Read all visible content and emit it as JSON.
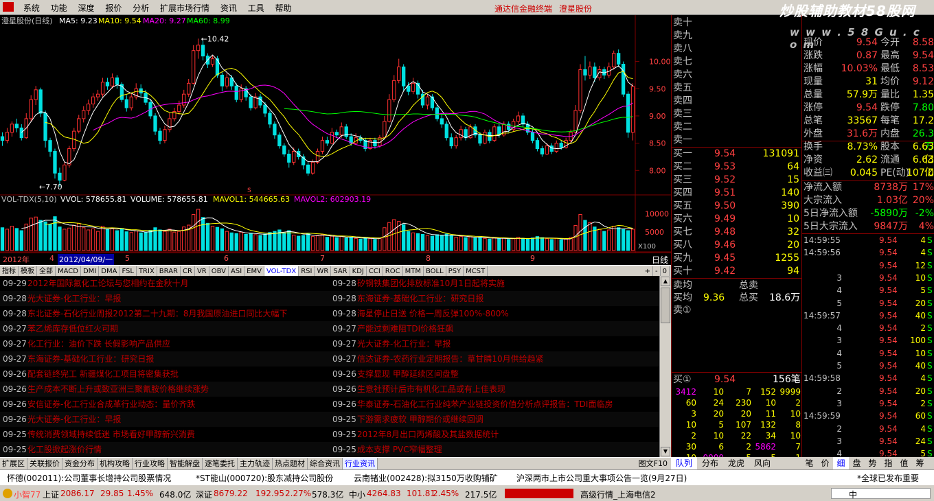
{
  "menu": {
    "items": [
      "系统",
      "功能",
      "深度",
      "报价",
      "分析",
      "扩展市场行情",
      "资讯",
      "工具",
      "帮助"
    ],
    "title_app": "通达信金融终端",
    "title_stock": "澄星股份",
    "watermark": "炒股辅助教材58股网",
    "watermark_url": "w w w . 5 8 G u . c o m"
  },
  "chart": {
    "header": {
      "name": "澄星股份(日线)",
      "ma5": "MA5: 9.23",
      "ma10": "MA10: 9.54",
      "ma20": "MA20: 9.27",
      "ma60": "MA60: 8.99"
    },
    "y_labels": [
      "10.00",
      "9.50",
      "9.00",
      "8.50",
      "8.00"
    ],
    "y_values": [
      10.0,
      9.5,
      9.0,
      8.5,
      8.0
    ],
    "y_range": [
      7.55,
      10.65
    ],
    "high_label": "10.42",
    "low_label": "7.70",
    "marker_label": "S",
    "vol_header": {
      "name": "VOL-TDX(5,10)",
      "vvol": "VVOL: 578655.81",
      "volume": "VOLUME: 578655.81",
      "mavol1": "MAVOL1: 544665.63",
      "mavol2": "MAVOL2: 602903.19"
    },
    "vol_labels": [
      "10000",
      "5000"
    ],
    "vol_values": [
      10000,
      5000
    ],
    "vol_range": [
      0,
      12500
    ],
    "vol_unit": "X100",
    "x_labels": [
      "2012年",
      "4",
      "5",
      "6",
      "7",
      "8",
      "9"
    ],
    "selected_date": "2012/04/09/一",
    "day_button": "日线"
  },
  "chart_data": {
    "type": "candlestick",
    "bars": [
      [
        8.62,
        8.55,
        8.7,
        8.45,
        6200
      ],
      [
        8.55,
        8.7,
        8.78,
        8.5,
        5800
      ],
      [
        8.7,
        8.85,
        8.9,
        8.62,
        6600
      ],
      [
        8.85,
        8.78,
        8.95,
        8.7,
        6000
      ],
      [
        8.78,
        8.6,
        8.85,
        8.55,
        5400
      ],
      [
        8.6,
        8.95,
        9.05,
        8.58,
        7200
      ],
      [
        8.95,
        9.3,
        9.38,
        8.9,
        8800
      ],
      [
        9.3,
        9.48,
        9.55,
        9.2,
        9100
      ],
      [
        9.48,
        9.05,
        9.52,
        8.98,
        8200
      ],
      [
        9.05,
        8.55,
        9.1,
        8.42,
        7800
      ],
      [
        8.55,
        8.35,
        8.6,
        8.25,
        7100
      ],
      [
        8.35,
        7.95,
        8.4,
        7.85,
        9200
      ],
      [
        7.95,
        7.82,
        8.05,
        7.7,
        6400
      ],
      [
        7.82,
        8.1,
        8.15,
        7.8,
        5800
      ],
      [
        8.1,
        8.4,
        8.45,
        8.05,
        6100
      ],
      [
        8.4,
        8.72,
        8.78,
        8.35,
        6800
      ],
      [
        8.72,
        8.95,
        9.02,
        8.68,
        7400
      ],
      [
        8.95,
        9.1,
        9.18,
        8.88,
        6200
      ],
      [
        9.1,
        9.22,
        9.3,
        9.02,
        5600
      ],
      [
        9.22,
        9.35,
        9.42,
        9.15,
        5900
      ],
      [
        9.35,
        9.4,
        9.48,
        9.28,
        5200
      ],
      [
        9.4,
        9.62,
        9.7,
        9.35,
        6600
      ],
      [
        9.62,
        9.55,
        9.7,
        9.48,
        5800
      ],
      [
        9.55,
        9.7,
        9.78,
        9.5,
        6100
      ],
      [
        9.7,
        9.58,
        9.75,
        9.5,
        5400
      ],
      [
        9.58,
        9.3,
        9.62,
        9.25,
        6000
      ],
      [
        9.3,
        9.15,
        9.38,
        9.08,
        5100
      ],
      [
        9.15,
        9.35,
        9.42,
        9.1,
        4900
      ],
      [
        9.35,
        9.5,
        9.6,
        9.3,
        5300
      ],
      [
        9.5,
        9.42,
        9.58,
        9.35,
        4800
      ],
      [
        9.42,
        9.25,
        9.48,
        9.2,
        5000
      ],
      [
        9.25,
        9.0,
        9.3,
        8.95,
        5500
      ],
      [
        9.0,
        8.72,
        9.05,
        8.65,
        6200
      ],
      [
        8.72,
        8.55,
        8.78,
        8.48,
        5600
      ],
      [
        8.55,
        8.75,
        8.82,
        8.5,
        5200
      ],
      [
        8.75,
        8.95,
        9.05,
        8.7,
        5800
      ],
      [
        8.95,
        9.08,
        9.15,
        8.9,
        5000
      ],
      [
        9.08,
        9.2,
        9.28,
        9.02,
        5200
      ],
      [
        9.2,
        9.4,
        9.48,
        9.15,
        6400
      ],
      [
        9.4,
        9.6,
        9.68,
        9.35,
        6900
      ],
      [
        9.6,
        10.2,
        10.3,
        9.58,
        9800
      ],
      [
        10.2,
        10.3,
        10.42,
        10.05,
        11200
      ],
      [
        10.3,
        10.1,
        10.38,
        10.02,
        9000
      ],
      [
        10.1,
        9.95,
        10.15,
        9.88,
        7400
      ],
      [
        9.95,
        10.05,
        10.12,
        9.9,
        6600
      ],
      [
        10.05,
        9.75,
        10.1,
        9.7,
        6300
      ],
      [
        9.75,
        9.55,
        9.8,
        9.45,
        5900
      ],
      [
        9.55,
        9.7,
        9.78,
        9.5,
        5200
      ],
      [
        9.7,
        9.55,
        9.75,
        9.48,
        4800
      ],
      [
        9.55,
        9.3,
        9.6,
        9.25,
        4600
      ],
      [
        9.3,
        9.5,
        9.58,
        9.25,
        5000
      ],
      [
        9.5,
        9.35,
        9.55,
        9.28,
        4400
      ],
      [
        9.35,
        9.15,
        9.4,
        9.1,
        4700
      ],
      [
        9.15,
        9.35,
        9.42,
        9.12,
        4300
      ],
      [
        9.35,
        9.2,
        9.4,
        9.15,
        4100
      ],
      [
        9.2,
        9.05,
        9.25,
        8.98,
        4500
      ],
      [
        9.05,
        8.85,
        9.1,
        8.78,
        4900
      ],
      [
        8.85,
        8.65,
        8.9,
        8.58,
        5200
      ],
      [
        8.65,
        8.45,
        8.7,
        8.4,
        5600
      ],
      [
        8.45,
        8.3,
        8.5,
        8.25,
        4800
      ],
      [
        8.3,
        8.15,
        8.38,
        8.05,
        5400
      ],
      [
        8.15,
        8.35,
        8.42,
        8.1,
        4200
      ],
      [
        8.35,
        8.25,
        8.4,
        8.2,
        3900
      ],
      [
        8.25,
        8.1,
        8.3,
        8.02,
        4100
      ],
      [
        8.1,
        7.95,
        8.15,
        7.9,
        4600
      ],
      [
        7.95,
        8.15,
        8.2,
        7.92,
        3800
      ],
      [
        8.15,
        8.35,
        8.4,
        8.12,
        4000
      ],
      [
        8.35,
        8.55,
        8.62,
        8.3,
        4400
      ],
      [
        8.55,
        8.5,
        8.62,
        8.45,
        3600
      ],
      [
        8.5,
        8.7,
        8.78,
        8.48,
        3900
      ],
      [
        8.7,
        8.65,
        8.75,
        8.6,
        3500
      ],
      [
        8.65,
        8.8,
        8.88,
        8.6,
        3800
      ],
      [
        8.8,
        8.62,
        8.85,
        8.58,
        3400
      ],
      [
        8.62,
        8.5,
        8.68,
        8.45,
        3600
      ],
      [
        8.5,
        8.6,
        8.68,
        8.48,
        3300
      ],
      [
        8.6,
        8.55,
        8.65,
        8.5,
        3100
      ],
      [
        8.55,
        8.4,
        8.6,
        8.35,
        3500
      ],
      [
        8.4,
        8.55,
        8.6,
        8.38,
        3200
      ],
      [
        8.55,
        8.45,
        8.6,
        8.4,
        3000
      ],
      [
        8.45,
        8.6,
        8.65,
        8.42,
        3400
      ],
      [
        8.6,
        8.9,
        9.0,
        8.58,
        6200
      ],
      [
        8.9,
        9.3,
        9.4,
        8.88,
        7600
      ],
      [
        9.3,
        9.65,
        9.75,
        9.25,
        8400
      ],
      [
        9.65,
        9.9,
        10.05,
        9.6,
        7900
      ],
      [
        9.9,
        9.55,
        9.95,
        9.45,
        7000
      ],
      [
        9.55,
        9.45,
        9.62,
        9.38,
        5200
      ],
      [
        9.45,
        9.6,
        9.7,
        9.4,
        4800
      ],
      [
        9.6,
        9.4,
        9.65,
        9.32,
        4600
      ],
      [
        9.4,
        9.2,
        9.48,
        9.15,
        4400
      ],
      [
        9.2,
        9.35,
        9.4,
        9.12,
        4100
      ],
      [
        9.35,
        9.15,
        9.4,
        9.1,
        3900
      ],
      [
        9.15,
        8.95,
        9.2,
        8.9,
        4300
      ],
      [
        8.95,
        8.85,
        9.02,
        8.78,
        4000
      ],
      [
        8.85,
        8.6,
        8.9,
        8.55,
        4500
      ],
      [
        8.6,
        8.45,
        8.68,
        8.4,
        4100
      ],
      [
        8.45,
        8.6,
        8.65,
        8.4,
        3600
      ],
      [
        8.6,
        8.75,
        8.82,
        8.55,
        3800
      ],
      [
        8.75,
        8.6,
        8.8,
        8.55,
        3500
      ],
      [
        8.6,
        8.8,
        8.85,
        8.58,
        3700
      ],
      [
        8.8,
        8.65,
        8.85,
        8.6,
        3400
      ],
      [
        8.65,
        8.5,
        8.7,
        8.45,
        3600
      ],
      [
        8.5,
        8.7,
        8.75,
        8.48,
        3300
      ],
      [
        8.7,
        8.55,
        8.75,
        8.5,
        3100
      ],
      [
        8.55,
        8.8,
        8.85,
        8.52,
        3500
      ],
      [
        8.8,
        8.65,
        8.85,
        8.6,
        3200
      ],
      [
        8.65,
        8.85,
        8.9,
        8.62,
        3400
      ],
      [
        8.85,
        8.75,
        8.9,
        8.7,
        3000
      ],
      [
        8.75,
        8.9,
        8.95,
        8.72,
        3200
      ],
      [
        8.9,
        9.0,
        9.08,
        8.85,
        3600
      ],
      [
        9.0,
        8.85,
        9.05,
        8.8,
        3300
      ],
      [
        8.85,
        8.7,
        8.9,
        8.65,
        3100
      ],
      [
        8.7,
        8.55,
        8.75,
        8.5,
        3400
      ],
      [
        8.55,
        8.4,
        8.6,
        8.35,
        3800
      ],
      [
        8.4,
        8.3,
        8.45,
        8.25,
        3500
      ],
      [
        8.3,
        8.45,
        8.5,
        8.28,
        3200
      ],
      [
        8.45,
        8.35,
        8.5,
        8.3,
        3000
      ],
      [
        8.35,
        8.5,
        8.55,
        8.32,
        3300
      ],
      [
        8.5,
        8.42,
        8.55,
        8.38,
        2900
      ],
      [
        8.42,
        8.55,
        8.6,
        8.4,
        3100
      ],
      [
        8.55,
        8.7,
        8.75,
        8.5,
        3600
      ],
      [
        8.7,
        9.1,
        9.2,
        8.68,
        6800
      ],
      [
        9.1,
        9.85,
        9.95,
        9.05,
        9800
      ],
      [
        9.85,
        9.75,
        10.1,
        9.65,
        8200
      ],
      [
        9.75,
        9.9,
        10.0,
        9.68,
        7600
      ],
      [
        9.9,
        9.7,
        9.98,
        9.62,
        6400
      ],
      [
        9.7,
        9.85,
        9.92,
        9.65,
        5800
      ],
      [
        9.85,
        9.75,
        9.9,
        9.68,
        5200
      ],
      [
        9.75,
        9.9,
        9.98,
        9.7,
        5600
      ],
      [
        9.9,
        10.15,
        10.2,
        9.85,
        6600
      ],
      [
        10.15,
        9.95,
        10.22,
        9.9,
        6200
      ],
      [
        9.95,
        9.4,
        10.0,
        9.35,
        5800
      ],
      [
        9.4,
        8.7,
        9.45,
        8.6,
        5400
      ],
      [
        8.7,
        9.54,
        9.6,
        8.55,
        5786
      ]
    ]
  },
  "indicator_tabs": [
    "指标",
    "模板",
    "全部",
    "MACD",
    "DMI",
    "DMA",
    "FSL",
    "TRIX",
    "BRAR",
    "CR",
    "VR",
    "OBV",
    "ASI",
    "EMV",
    "VOL-TDX",
    "RSI",
    "WR",
    "SAR",
    "KDJ",
    "CCI",
    "ROC",
    "MTM",
    "BOLL",
    "PSY",
    "MCST"
  ],
  "indicator_controls": [
    "+",
    "-",
    "0"
  ],
  "news": {
    "left": [
      [
        "09-29",
        "2012年国际氟化工论坛与您相约在金秋十月"
      ],
      [
        "09-28",
        "光大证券-化工行业：早报"
      ],
      [
        "09-28",
        "东北证券-石化行业周报2012第二十九期：8月我国原油进口同比大幅下"
      ],
      [
        "09-27",
        "苯乙烯库存低位红火可期"
      ],
      [
        "09-27",
        "化工行业：油价下跌 长假影响产品供应"
      ],
      [
        "09-27",
        "东海证券-基础化工行业：研究日报"
      ],
      [
        "09-26",
        "配套链终完工 新疆煤化工项目将密集获批"
      ],
      [
        "09-26",
        "生产成本不断上升或致亚洲三聚氰胺价格继续涨势"
      ],
      [
        "09-26",
        "安信证券-化工行业合成革行业动态：量价齐跌"
      ],
      [
        "09-26",
        "光大证券-化工行业：早报"
      ],
      [
        "09-25",
        "传统消费领域持续低迷 市场看好甲醇新兴消费"
      ],
      [
        "09-25",
        "化工股掀起涨价行情"
      ]
    ],
    "right": [
      [
        "09-28",
        "矽钢铁集团化排放标准10月1日起将实施"
      ],
      [
        "09-28",
        "东海证券-基础化工行业：研究日报"
      ],
      [
        "09-28",
        "海星停止日送 价格一周反弹100%-800%"
      ],
      [
        "09-27",
        "产能过剩难阻TDI价格狂飙"
      ],
      [
        "09-27",
        "光大证券-化工行业：早报"
      ],
      [
        "09-27",
        "信达证券-农药行业定期报告：草甘膦10月供给趋紧"
      ],
      [
        "09-26",
        "支撑显现 甲醇延续区间盘整"
      ],
      [
        "09-26",
        "生意社预计后市有机化工品或有上佳表现"
      ],
      [
        "09-26",
        "华泰证券-石油化工行业纯苯产业链投资价值分析点评报告：TDI面临房"
      ],
      [
        "09-25",
        "下游需求疲软 甲醇期价或继续回调"
      ],
      [
        "09-25",
        "2012年8月出口丙烯酸及其盐数据统计"
      ],
      [
        "09-25",
        "成本支撑 PVC窄幅整理"
      ]
    ]
  },
  "bottom_tabs": [
    "扩展区",
    "关联报价",
    "资金分布",
    "机构攻略",
    "行业攻略",
    "智能解盘",
    "逐笔委托",
    "主力轨迹",
    "热点题材",
    "综合资讯",
    "行业资讯"
  ],
  "bottom_right": "图文F10",
  "order_book": {
    "sell": [
      [
        "卖十",
        "",
        ""
      ],
      [
        "卖九",
        "",
        ""
      ],
      [
        "卖八",
        "",
        ""
      ],
      [
        "卖七",
        "",
        ""
      ],
      [
        "卖六",
        "",
        ""
      ],
      [
        "卖五",
        "",
        ""
      ],
      [
        "卖四",
        "",
        ""
      ],
      [
        "卖三",
        "",
        ""
      ],
      [
        "卖二",
        "",
        ""
      ],
      [
        "卖一",
        "",
        ""
      ]
    ],
    "buy": [
      [
        "买一",
        "9.54",
        "131091"
      ],
      [
        "买二",
        "9.53",
        "64"
      ],
      [
        "买三",
        "9.52",
        "15"
      ],
      [
        "买四",
        "9.51",
        "140"
      ],
      [
        "买五",
        "9.50",
        "390"
      ],
      [
        "买六",
        "9.49",
        "10"
      ],
      [
        "买七",
        "9.48",
        "32"
      ],
      [
        "买八",
        "9.46",
        "20"
      ],
      [
        "买九",
        "9.45",
        "1255"
      ],
      [
        "买十",
        "9.42",
        "94"
      ]
    ],
    "sell_avg_label": "卖均",
    "total_sell_label": "总卖",
    "buy_avg_label": "买均",
    "buy_avg": "9.36",
    "total_buy_label": "总买",
    "total_buy": "18.6万",
    "sell1_label": "卖①",
    "buy1_label": "买①",
    "buy1_price": "9.54",
    "buy1_count": "156笔",
    "queue": [
      [
        "3412",
        "10",
        "7",
        "152",
        "9999"
      ],
      [
        "60",
        "24",
        "230",
        "10",
        "2"
      ],
      [
        "3",
        "20",
        "20",
        "11",
        "10"
      ],
      [
        "10",
        "5",
        "107",
        "132",
        "8"
      ],
      [
        "2",
        "10",
        "22",
        "34",
        "10"
      ],
      [
        "30",
        "6",
        "2",
        "5862",
        "7"
      ],
      [
        "10",
        "0000",
        "5",
        "5",
        "1"
      ]
    ]
  },
  "right_tabs": [
    "队列",
    "分布",
    "龙虎",
    "风向"
  ],
  "quote": {
    "rows": [
      [
        "现价",
        "9.54",
        "今开",
        "8.58"
      ],
      [
        "涨跌",
        "0.87",
        "最高",
        "9.54"
      ],
      [
        "涨幅",
        "10.03%",
        "最低",
        "8.53"
      ],
      [
        "现量",
        "31",
        "均价",
        "9.12"
      ],
      [
        "总量",
        "57.9万",
        "量比",
        "1.35"
      ],
      [
        "涨停",
        "9.54",
        "跌停",
        "7.80"
      ],
      [
        "总笔",
        "33567",
        "每笔",
        "17.2"
      ],
      [
        "外盘",
        "31.6万",
        "内盘",
        "26.3万"
      ],
      [
        "换手",
        "8.73%",
        "股本",
        "6.63亿"
      ],
      [
        "净资",
        "2.62",
        "流通",
        "6.63亿"
      ],
      [
        "收益㈢",
        "0.045",
        "PE(动)",
        "107.0"
      ]
    ],
    "flows": [
      [
        "净流入额",
        "8738万",
        "17%"
      ],
      [
        "大宗流入",
        "1.03亿",
        "20%"
      ],
      [
        "5日净流入额",
        "-5890万",
        "-2%"
      ],
      [
        "5日大宗流入",
        "9847万",
        "4%"
      ]
    ]
  },
  "ticks": [
    [
      "14:59:55",
      "9.54",
      "4",
      "S"
    ],
    [
      "14:59:56",
      "9.54",
      "4",
      "S"
    ],
    [
      "",
      "9.54",
      "12",
      "S"
    ],
    [
      "3",
      "9.54",
      "10",
      "S"
    ],
    [
      "4",
      "9.54",
      "5",
      "S"
    ],
    [
      "5",
      "9.54",
      "20",
      "S"
    ],
    [
      "14:59:57",
      "9.54",
      "40",
      "S"
    ],
    [
      "4",
      "9.54",
      "2",
      "S"
    ],
    [
      "3",
      "9.54",
      "100",
      "S"
    ],
    [
      "4",
      "9.54",
      "10",
      "S"
    ],
    [
      "5",
      "9.54",
      "40",
      "S"
    ],
    [
      "14:59:58",
      "9.54",
      "4",
      "S"
    ],
    [
      "2",
      "9.54",
      "20",
      "S"
    ],
    [
      "3",
      "9.54",
      "2",
      "S"
    ],
    [
      "14:59:59",
      "9.54",
      "60",
      "S"
    ],
    [
      "2",
      "9.54",
      "4",
      "S"
    ],
    [
      "3",
      "9.54",
      "24",
      "S"
    ],
    [
      "4",
      "9.54",
      "5",
      "S"
    ]
  ],
  "right_tabs2": [
    "笔",
    "价",
    "细",
    "盘",
    "势",
    "指",
    "值",
    "筹"
  ],
  "ticker": [
    "怀德(002011):公司董事长增持公司股票情况",
    "*ST能山(000720):股东减持公司股份",
    "云南锗业(002428):拟3150万收购铺矿",
    "沪深两市上市公司重大事项公告一览(9月27日)",
    "*全球已发布重要"
  ],
  "status": {
    "user": "小智77",
    "sh": "上证",
    "sh_val": "2086.17",
    "sh_chg": "29.85",
    "sh_pct": "1.45%",
    "sh_amt": "648.0亿",
    "sz": "深证",
    "sz_val": "8679.22",
    "sz_chg": "192.95",
    "sz_pct": "2.27%",
    "sz_amt": "578.3亿",
    "zx": "中小",
    "zx_val": "4264.83",
    "zx_chg": "101.81",
    "zx_pct": "2.45%",
    "zx_amt": "217.5亿",
    "server": "高级行情_上海电信2",
    "ime": "中"
  }
}
